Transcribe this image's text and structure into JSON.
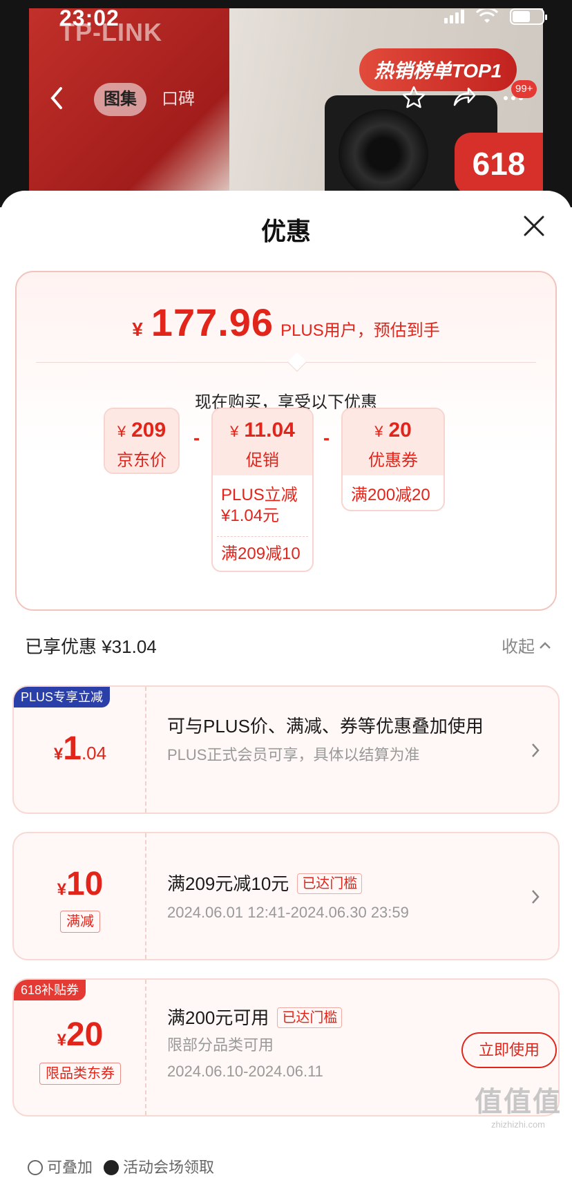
{
  "status_bar": {
    "time": "23:02"
  },
  "banner": {
    "brand": "TP-LINK",
    "hot_badge": "热销榜单TOP1",
    "promo_618": "618",
    "tabs": [
      {
        "label": "图集"
      },
      {
        "label": "口碑"
      }
    ],
    "badge_count": "99+"
  },
  "sheet": {
    "title": "优惠",
    "summary": {
      "yen": "¥",
      "price": "177.96",
      "price_note": "PLUS用户，预估到手",
      "subhead": "现在购买，享受以下优惠",
      "minus": "-",
      "chips": [
        {
          "yen": "¥",
          "value": "209",
          "label": "京东价"
        },
        {
          "yen": "¥",
          "value": "11.04",
          "label": "促销",
          "details": [
            "PLUS立减 ¥1.04元",
            "满209减10"
          ]
        },
        {
          "yen": "¥",
          "value": "20",
          "label": "优惠券",
          "details": [
            "满200减20"
          ]
        }
      ]
    },
    "enjoyed": {
      "label": "已享优惠 ¥31.04",
      "collapse": "收起"
    },
    "cards": [
      {
        "tag": "PLUS专享立减",
        "amount_int": "1",
        "amount_dec": ".04",
        "title": "可与PLUS价、满减、券等优惠叠加使用",
        "subtitle": "PLUS正式会员可享，具体以结算为准"
      },
      {
        "amount_int": "10",
        "type_chip": "满减",
        "title": "满209元减10元",
        "threshold": "已达门槛",
        "subtitle": "2024.06.01 12:41-2024.06.30 23:59"
      },
      {
        "tag": "618补贴券",
        "amount_int": "20",
        "type_chip": "限品类东券",
        "title": "满200元可用",
        "threshold": "已达门槛",
        "subtitle": "限部分品类可用",
        "date": "2024.06.10-2024.06.11",
        "use_button": "立即使用"
      }
    ],
    "footer": {
      "stackable": "可叠加",
      "venue": "活动会场领取"
    }
  },
  "watermark": {
    "big": "值值值",
    "small": "zhizhizhi.com"
  },
  "colors": {
    "accent": "#e1251b",
    "plus_blue": "#2b3fa8",
    "tag_red": "#e53a33"
  }
}
